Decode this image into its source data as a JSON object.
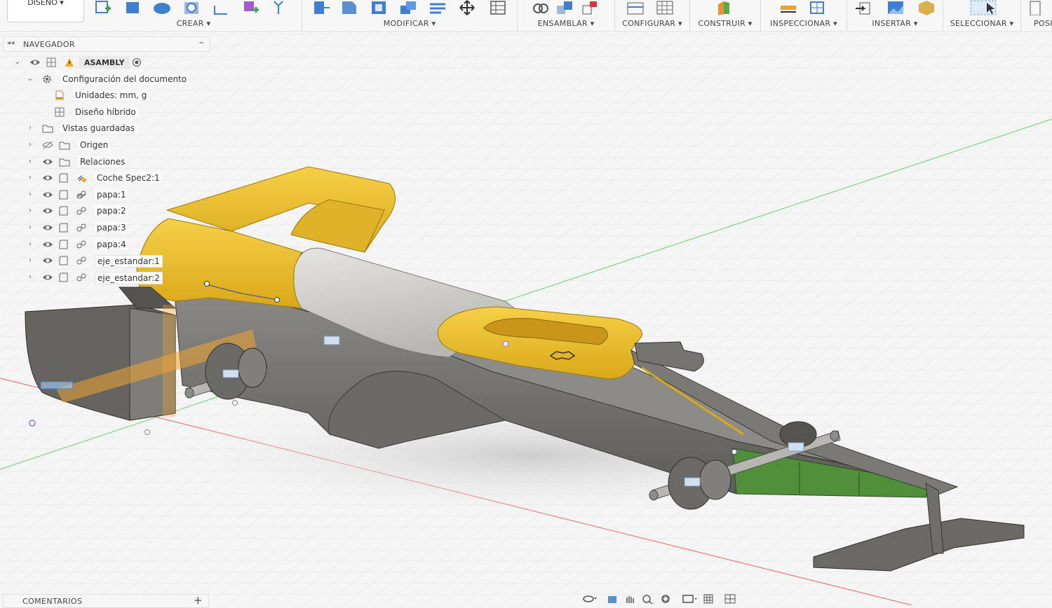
{
  "toolbar": {
    "workspace_label": "DISEÑO",
    "groups": [
      {
        "label": "CREAR"
      },
      {
        "label": "MODIFICAR"
      },
      {
        "label": "ENSAMBLAR"
      },
      {
        "label": "CONFIGURAR"
      },
      {
        "label": "CONSTRUIR"
      },
      {
        "label": "INSPECCIONAR"
      },
      {
        "label": "INSERTAR"
      },
      {
        "label": "SELECCIONAR"
      },
      {
        "label": "POSI"
      }
    ]
  },
  "navigator": {
    "title": "NAVEGADOR",
    "root": "ASAMBLY",
    "items": [
      {
        "label": "Configuración del documento",
        "icon": "gear-icon"
      },
      {
        "label": "Unidades: mm, g",
        "icon": "document-icon"
      },
      {
        "label": "Diseño híbrido",
        "icon": "hybrid-design-icon"
      },
      {
        "label": "Vistas guardadas",
        "icon": "folder-icon"
      },
      {
        "label": "Origen",
        "icon": "folder-icon"
      },
      {
        "label": "Relaciones",
        "icon": "folder-icon"
      },
      {
        "label": "Coche Spec2:1",
        "icon": "component-icon"
      },
      {
        "label": "papa:1",
        "icon": "component-icon"
      },
      {
        "label": "papa:2",
        "icon": "component-icon"
      },
      {
        "label": "papa:3",
        "icon": "component-icon"
      },
      {
        "label": "papa:4",
        "icon": "component-icon"
      },
      {
        "label": "eje_estandar:1",
        "icon": "component-icon"
      },
      {
        "label": "eje_estandar:2",
        "icon": "component-icon"
      }
    ]
  },
  "comments": {
    "title": "COMENTARIOS"
  },
  "colors": {
    "body_gray": "#6f6e6a",
    "wing_yellow": "#f2c22e",
    "nose_green": "#4f8f3a",
    "cylinder_gray": "#d4d2cc"
  }
}
